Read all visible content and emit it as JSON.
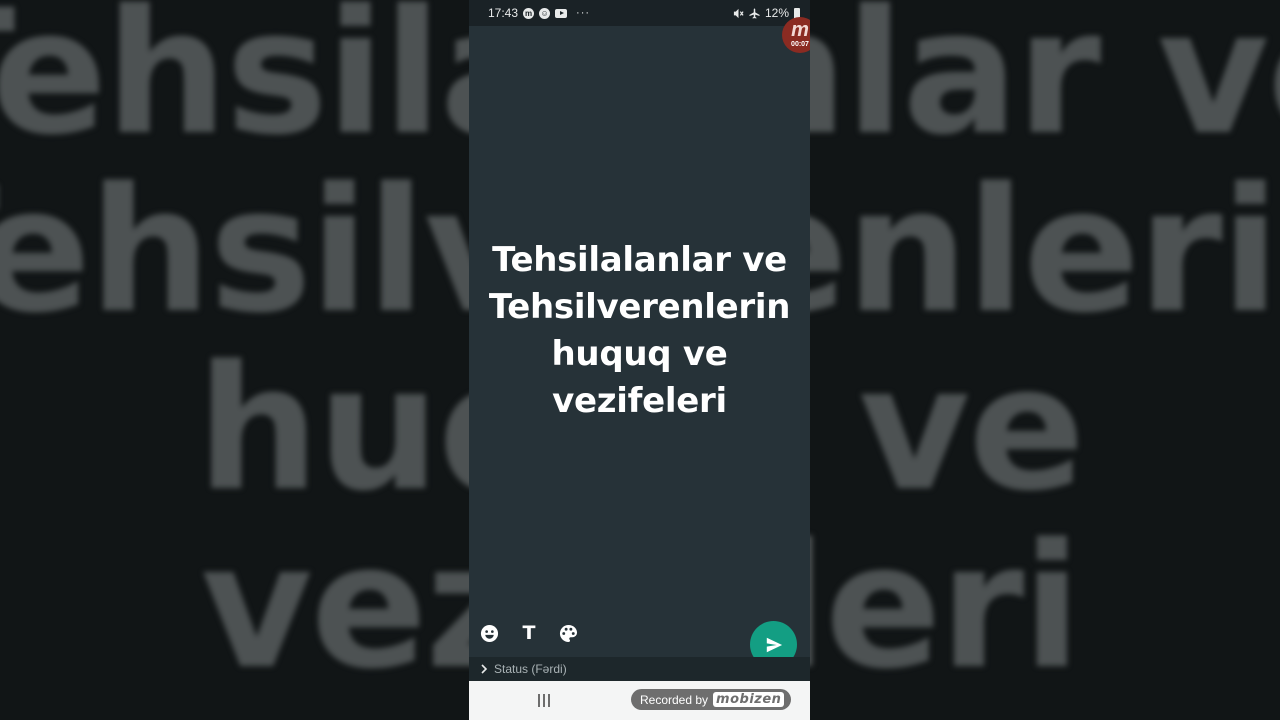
{
  "status_bar": {
    "time": "17:43",
    "notification_icons": [
      "messenger-icon",
      "smiley-notification-icon",
      "youtube-icon"
    ],
    "more_dots": "···",
    "battery_percent": "12%",
    "status_icons": [
      "mute-icon",
      "airplane-icon",
      "battery-icon"
    ]
  },
  "recording_badge": {
    "logo_letter": "m",
    "elapsed": "00:07",
    "color": "#8b2b22"
  },
  "status_composer": {
    "text": "Tehsilalanlar ve\nTehsilverenlerin\nhuquq ve\nvezifeleri",
    "background_color": "#263238",
    "tools": [
      "emoji-icon",
      "text-style-icon",
      "palette-icon"
    ],
    "text_tool_label": "T",
    "send_color": "#139e83"
  },
  "audience": {
    "label": "Status (Fərdi)"
  },
  "navigation": {
    "recorded_by_label": "Recorded by",
    "recorder_brand": "mobizen"
  }
}
